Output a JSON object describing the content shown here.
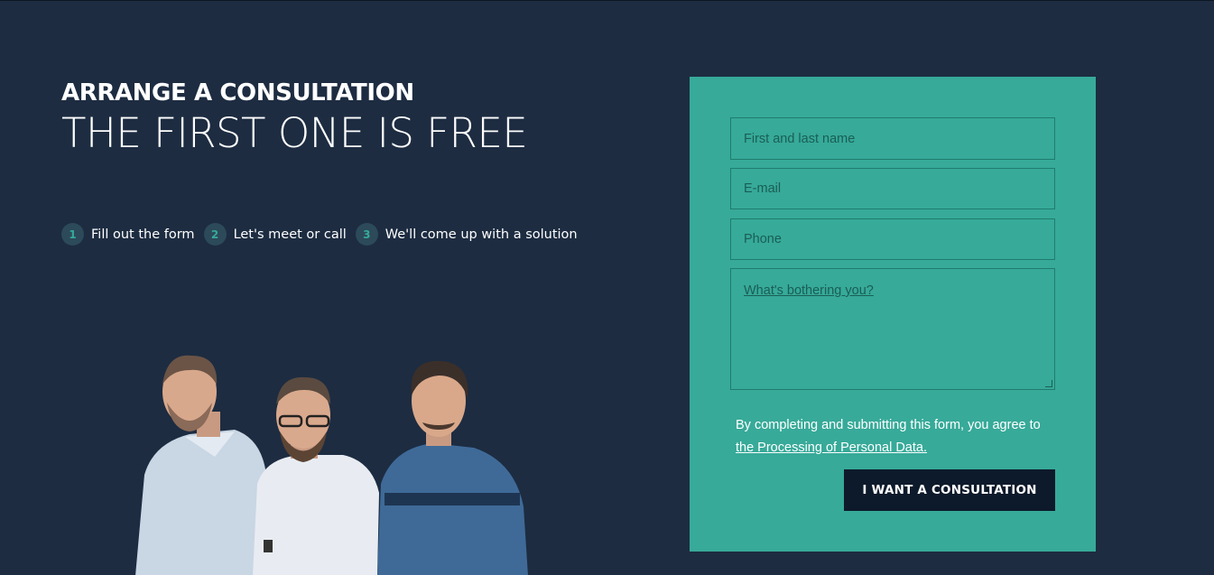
{
  "hero": {
    "kicker": "ARRANGE A CONSULTATION",
    "headline": "THE FIRST ONE IS FREE"
  },
  "steps": [
    {
      "num": "1",
      "label": "Fill out the form"
    },
    {
      "num": "2",
      "label": "Let's meet or call"
    },
    {
      "num": "3",
      "label": "We'll come up with a solution"
    }
  ],
  "form": {
    "name_placeholder": "First and last name",
    "email_placeholder": "E-mail",
    "phone_placeholder": "Phone",
    "message_placeholder": "What's bothering you?",
    "consent_text": "By completing and submitting this form, you agree to",
    "consent_link": "the Processing of Personal Data.",
    "submit_label": "I WANT A CONSULTATION"
  },
  "colors": {
    "background": "#1d2c41",
    "form_panel": "#37aa99",
    "submit_button": "#0d1a2b"
  }
}
